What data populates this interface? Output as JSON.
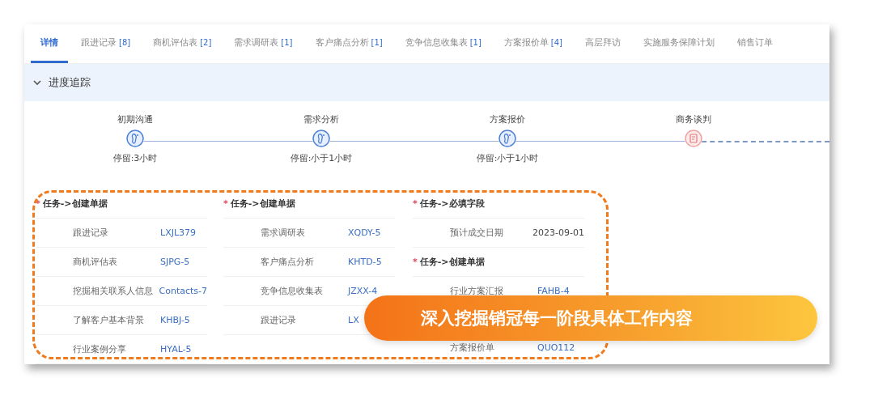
{
  "tabs": [
    {
      "label": "详情",
      "selected": true
    },
    {
      "label": "跟进记录",
      "count": "[8]",
      "selected": false
    },
    {
      "label": "商机评估表",
      "count": "[2]",
      "selected": false
    },
    {
      "label": "需求调研表",
      "count": "[1]",
      "selected": false
    },
    {
      "label": "客户痛点分析",
      "count": "[1]",
      "selected": false
    },
    {
      "label": "竞争信息收集表",
      "count": "[1]",
      "selected": false
    },
    {
      "label": "方案报价单",
      "count": "[4]",
      "selected": false
    },
    {
      "label": "高层拜访",
      "selected": false
    },
    {
      "label": "实施服务保障计划",
      "selected": false
    },
    {
      "label": "销售订单",
      "selected": false
    }
  ],
  "section": {
    "title": "进度追踪",
    "expanded": true
  },
  "steps": [
    {
      "label": "初期沟通",
      "stay": "停留:3小时",
      "kind": "done"
    },
    {
      "label": "需求分析",
      "stay": "停留:小于1小时",
      "kind": "done"
    },
    {
      "label": "方案报价",
      "stay": "停留:小于1小时",
      "kind": "done"
    },
    {
      "label": "商务谈判",
      "kind": "current"
    }
  ],
  "task_columns": [
    {
      "items": [
        {
          "kind": "header",
          "title": "任务->创建单据",
          "required_mark": "*"
        },
        {
          "kind": "row",
          "label": "跟进记录",
          "value": "LXJL379",
          "link": true
        },
        {
          "kind": "row",
          "label": "商机评估表",
          "value": "SJPG-5",
          "link": true
        },
        {
          "kind": "row",
          "label": "挖掘相关联系人信息",
          "value": "Contacts-7",
          "link": true
        },
        {
          "kind": "row",
          "label": "了解客户基本背景",
          "value": "KHBJ-5",
          "link": true
        },
        {
          "kind": "row",
          "label": "行业案例分享",
          "value": "HYAL-5",
          "link": true
        }
      ]
    },
    {
      "items": [
        {
          "kind": "header",
          "title": "任务->创建单据",
          "required_mark": "*"
        },
        {
          "kind": "row",
          "label": "需求调研表",
          "value": "XQDY-5",
          "link": true
        },
        {
          "kind": "row",
          "label": "客户痛点分析",
          "value": "KHTD-5",
          "link": true
        },
        {
          "kind": "row",
          "label": "竞争信息收集表",
          "value": "JZXX-4",
          "link": true
        },
        {
          "kind": "row",
          "label": "跟进记录",
          "value": "LX",
          "link": true
        }
      ]
    },
    {
      "items": [
        {
          "kind": "header",
          "title": "任务->必填字段",
          "required_mark": "*"
        },
        {
          "kind": "row",
          "label": "预计成交日期",
          "value": "2023-09-01",
          "link": false
        },
        {
          "kind": "header",
          "title": "任务->创建单据",
          "required_mark": "*"
        },
        {
          "kind": "row",
          "label": "行业方案汇报",
          "value": "FAHB-4",
          "link": true
        },
        {
          "kind": "row",
          "label": "方案报价单",
          "value": "QUO112",
          "link": true
        }
      ]
    }
  ],
  "banner": {
    "text": "深入挖掘销冠每一阶段具体工作内容"
  }
}
